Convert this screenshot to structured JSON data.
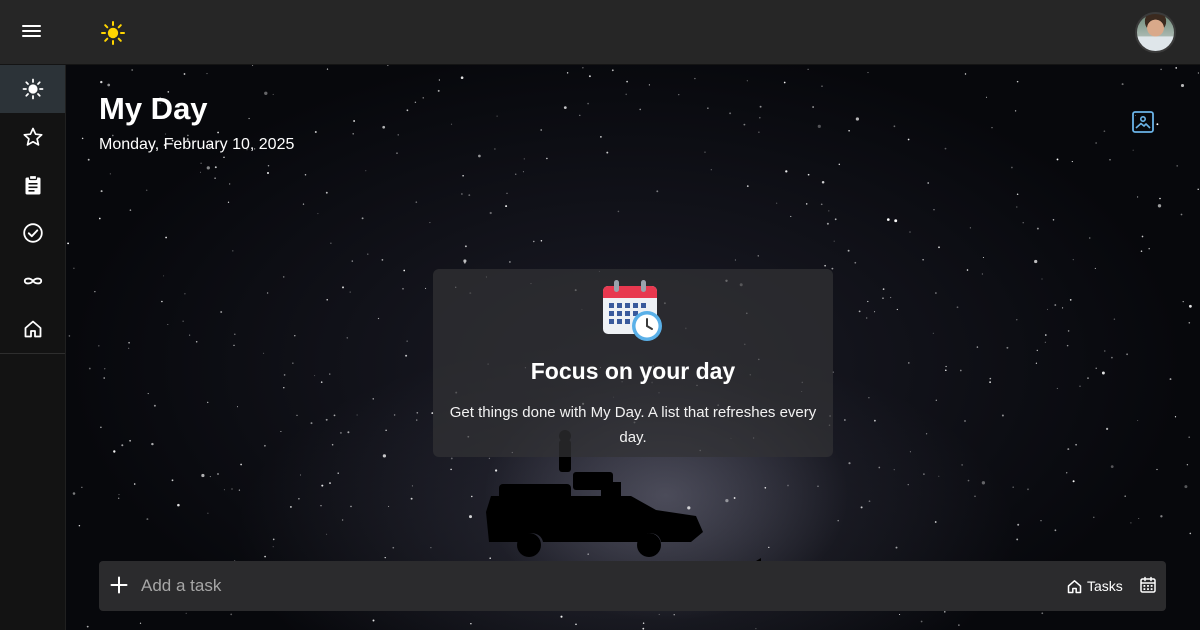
{
  "topbar": {
    "menu_icon": "hamburger-icon",
    "app_icon": "sun-icon",
    "avatar": "user-avatar"
  },
  "sidebar": {
    "items": [
      {
        "icon": "sun-icon",
        "active": true
      },
      {
        "icon": "star-icon",
        "active": false
      },
      {
        "icon": "clipboard-icon",
        "active": false
      },
      {
        "icon": "check-circle-icon",
        "active": false
      },
      {
        "icon": "infinity-icon",
        "active": false
      },
      {
        "icon": "home-icon",
        "active": false
      }
    ]
  },
  "main": {
    "title": "My Day",
    "date": "Monday, February 10, 2025",
    "background_button_icon": "image-icon"
  },
  "empty_state": {
    "illustration": "calendar-clock-icon",
    "title": "Focus on your day",
    "text": "Get things done with My Day. A list that refreshes every day."
  },
  "add_task": {
    "placeholder": "Add a task",
    "value": "",
    "list_label": "Tasks",
    "list_icon": "home-icon",
    "due_icon": "calendar-icon"
  },
  "colors": {
    "topbar": "#262626",
    "sidebar": "#131313",
    "active_nav": "#2c3338",
    "sun": "#ffd500",
    "accent": "#6bb4e8",
    "input_bar": "#2b2b2d"
  }
}
